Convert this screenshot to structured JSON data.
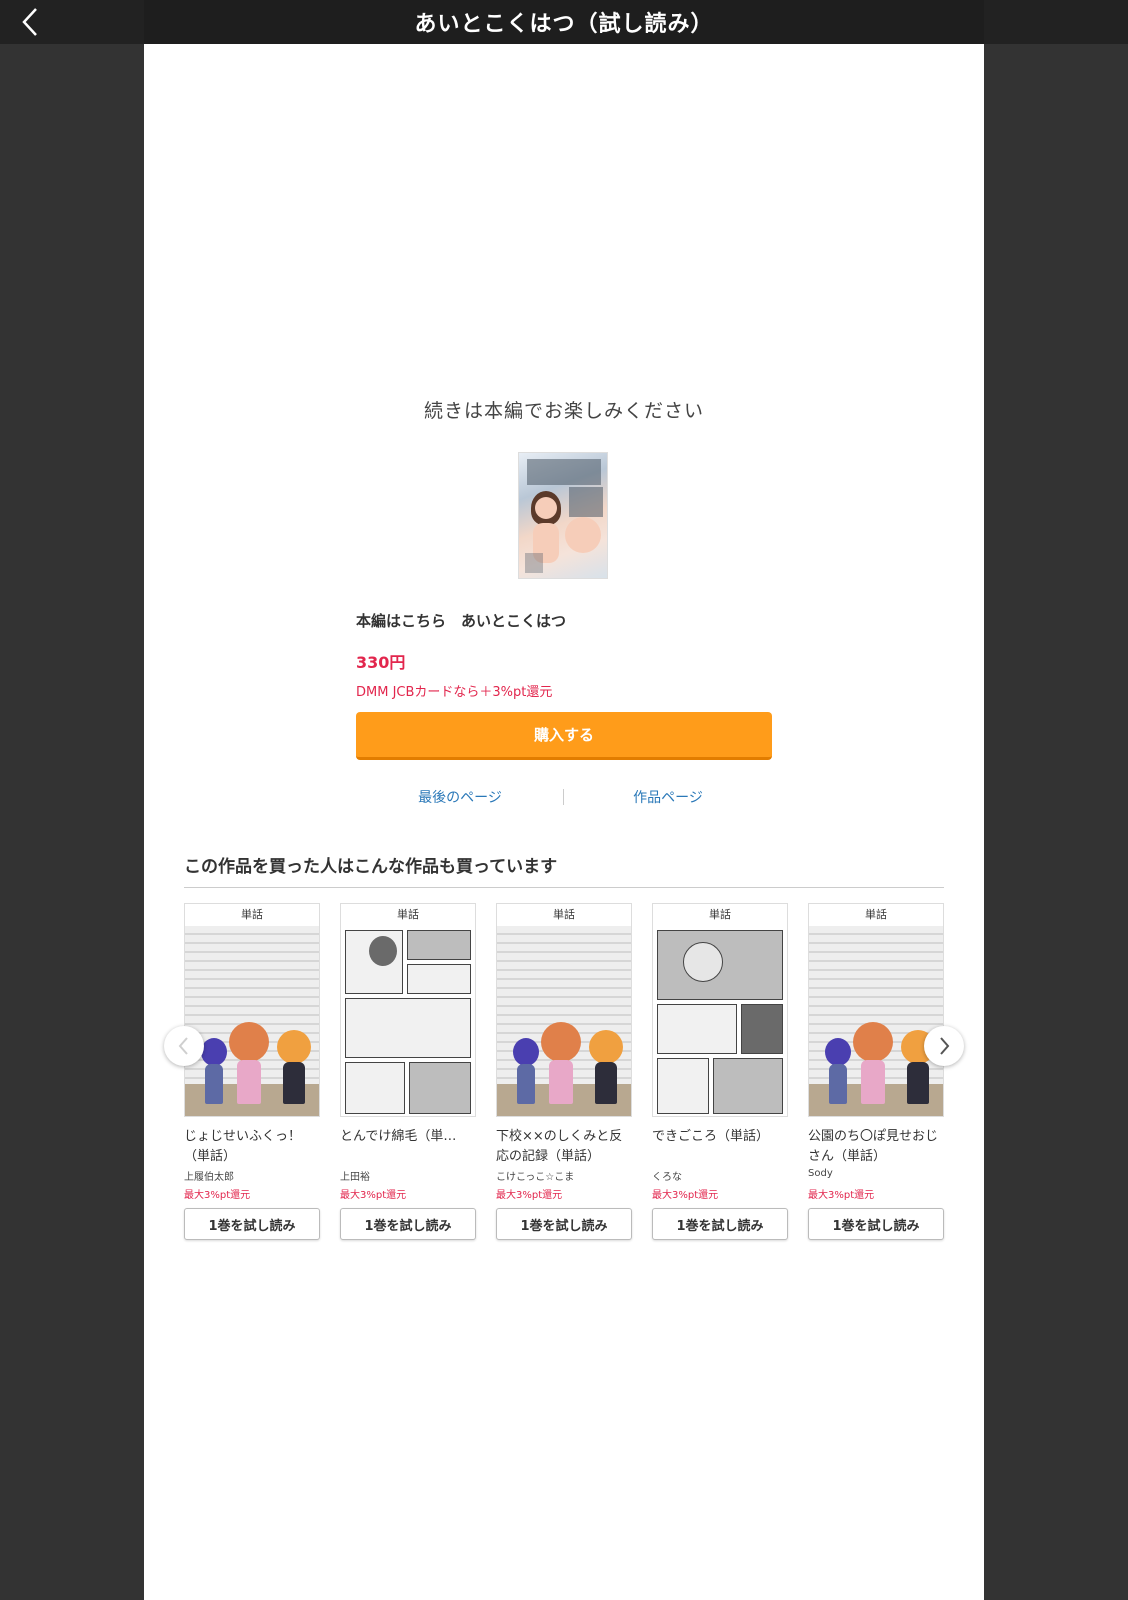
{
  "header": {
    "title": "あいとこくはつ（試し読み）"
  },
  "main": {
    "continue_message": "続きは本編でお楽しみください",
    "purchase": {
      "title": "本編はこちら　あいとこくはつ",
      "price": "330円",
      "card_note": "DMM JCBカードなら＋3%pt還元",
      "buy_label": "購入する"
    },
    "links": {
      "last_page": "最後のページ",
      "work_page": "作品ページ"
    }
  },
  "recommend": {
    "heading": "この作品を買った人はこんな作品も買っています",
    "items": [
      {
        "badge": "単話",
        "title": "じょじせいふくっ！（単話）",
        "author": "上履伯太郎",
        "points": "最大3%pt還元",
        "button": "1巻を試し読み",
        "image": "placeholder"
      },
      {
        "badge": "単話",
        "title": "とんでけ綿毛（単…",
        "author": "上田裕",
        "points": "最大3%pt還元",
        "button": "1巻を試し読み",
        "image": "manga"
      },
      {
        "badge": "単話",
        "title": "下校××のしくみと反応の記録（単話）",
        "author": "こけこっこ☆こま",
        "points": "最大3%pt還元",
        "button": "1巻を試し読み",
        "image": "placeholder"
      },
      {
        "badge": "単話",
        "title": "できごころ（単話）",
        "author": "くろな",
        "points": "最大3%pt還元",
        "button": "1巻を試し読み",
        "image": "manga"
      },
      {
        "badge": "単話",
        "title": "公園のち〇ぽ見せおじさん（単話）",
        "author": "Sody",
        "points": "最大3%pt還元",
        "button": "1巻を試し読み",
        "image": "placeholder"
      }
    ]
  },
  "icons": {
    "back": "chevron-left-icon",
    "prev": "chevron-left-icon",
    "next": "chevron-right-icon"
  },
  "colors": {
    "accent_orange": "#ff9c1a",
    "price_red": "#e2264d",
    "link_blue": "#2a78b8",
    "header_bg": "#222222",
    "side_bg": "#333333"
  }
}
